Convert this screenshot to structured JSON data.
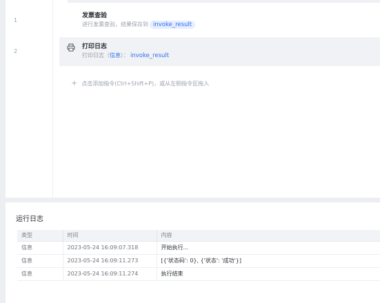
{
  "editor": {
    "commands": [
      {
        "line": "1",
        "title": "发票查验",
        "desc_prefix": "进行发票查验，结果保存到",
        "var": "invoke_result",
        "selected": false
      },
      {
        "line": "2",
        "title": "打印日志",
        "desc_prefix": "打印日志（",
        "desc_level": "信息",
        "desc_suffix": "）：",
        "var": "invoke_result",
        "icon": "printer-icon",
        "selected": true
      }
    ],
    "add_hint": "点击添加指令(Ctrl+Shift+P)，或从左侧指令区拖入"
  },
  "log": {
    "title": "运行日志",
    "columns": [
      "类型",
      "时间",
      "内容"
    ],
    "rows": [
      {
        "type": "信息",
        "time": "2023-05-24 16:09:07.318",
        "content": "开始执行..."
      },
      {
        "type": "信息",
        "time": "2023-05-24 16:09:11.273",
        "content": "[{'状态码': 0}, {'状态': '成功'}]"
      },
      {
        "type": "信息",
        "time": "2023-05-24 16:09:11.274",
        "content": "执行结束"
      }
    ]
  },
  "colors": {
    "accent": "#2f6ff0",
    "chip_bg": "#e6efff",
    "selected_bg": "#f0f2f5"
  }
}
